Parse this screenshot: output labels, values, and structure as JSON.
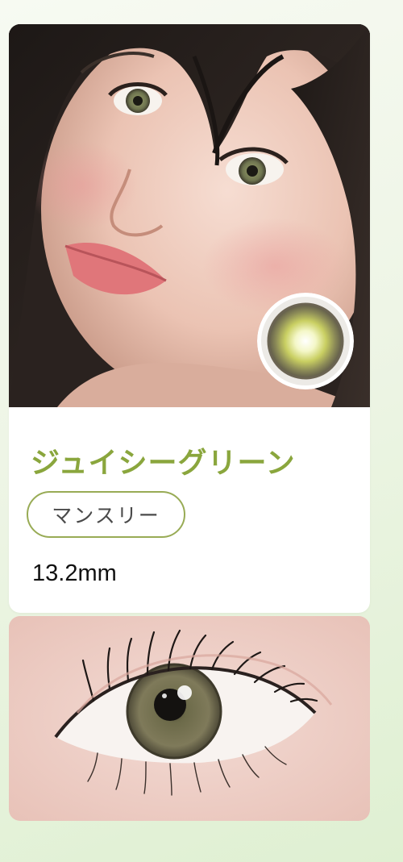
{
  "product": {
    "name": "ジュイシーグリーン",
    "period": "マンスリー",
    "diameter": "13.2mm"
  },
  "images": {
    "model_photo": "model-face-photo",
    "lens_swatch": "green-lens-swatch",
    "eye_closeup": "eye-closeup-photo"
  },
  "colors": {
    "name_green": "#8aa63d",
    "badge_border": "#98ab55",
    "background_tint": "#dff0d2"
  }
}
